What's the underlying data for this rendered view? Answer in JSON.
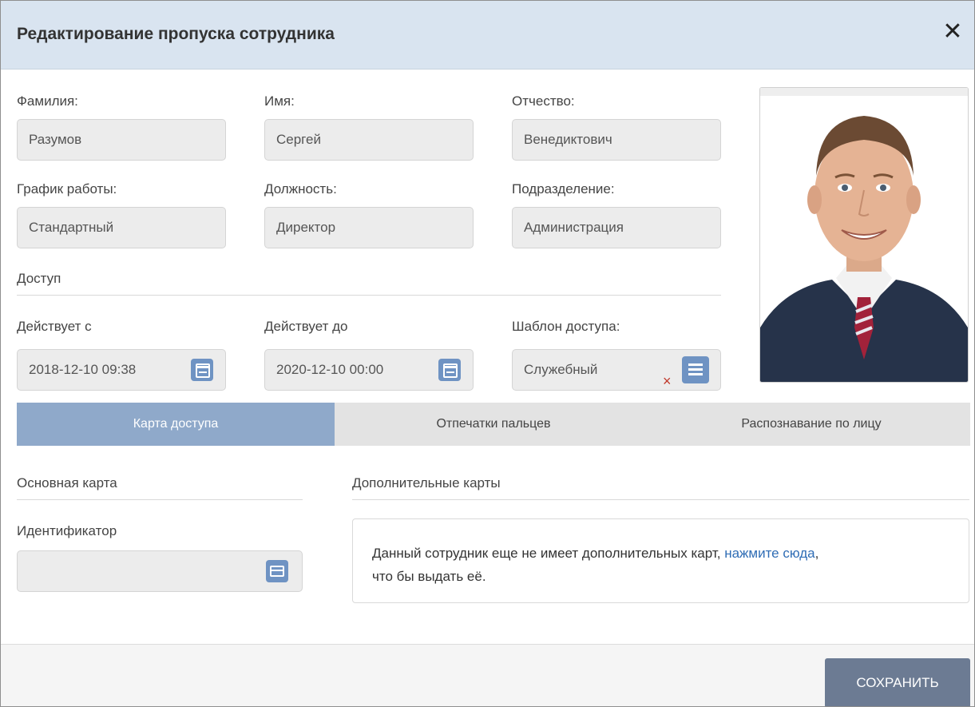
{
  "dialog": {
    "title": "Редактирование пропуска сотрудника",
    "close_glyph": "✕"
  },
  "fields": {
    "last_name": {
      "label": "Фамилия:",
      "value": "Разумов"
    },
    "first_name": {
      "label": "Имя:",
      "value": "Сергей"
    },
    "middle_name": {
      "label": "Отчество:",
      "value": "Венедиктович"
    },
    "schedule": {
      "label": "График работы:",
      "value": "Стандартный"
    },
    "position": {
      "label": "Должность:",
      "value": "Директор"
    },
    "department": {
      "label": "Подразделение:",
      "value": "Администрация"
    }
  },
  "access": {
    "section_label": "Доступ",
    "valid_from": {
      "label": "Действует с",
      "value": "2018-12-10 09:38"
    },
    "valid_to": {
      "label": "Действует до",
      "value": "2020-12-10 00:00"
    },
    "template": {
      "label": "Шаблон доступа:",
      "value": "Служебный",
      "clear_glyph": "×"
    }
  },
  "tabs": [
    {
      "label": "Карта доступа",
      "active": true
    },
    {
      "label": "Отпечатки пальцев",
      "active": false
    },
    {
      "label": "Распознавание по лицу",
      "active": false
    }
  ],
  "card": {
    "main_card_label": "Основная карта",
    "extra_cards_label": "Дополнительные карты",
    "identifier_label": "Идентификатор",
    "identifier_value": "",
    "notice_text": "Данный сотрудник еще не имеет дополнительных карт, ",
    "notice_link": "нажмите сюда",
    "notice_tail": ",",
    "notice_text2": "что бы выдать её."
  },
  "footer": {
    "save_label": "СОХРАНИТЬ"
  },
  "colors": {
    "header_bg": "#d9e4f0",
    "accent": "#6f93c3",
    "active_tab": "#8fa9ca",
    "save_button": "#6c7b93",
    "link": "#2f6db5",
    "clear_icon": "#c0392b"
  },
  "icons": {
    "close": "close-icon",
    "calendar": "calendar-icon",
    "list": "list-icon",
    "card": "card-icon"
  }
}
